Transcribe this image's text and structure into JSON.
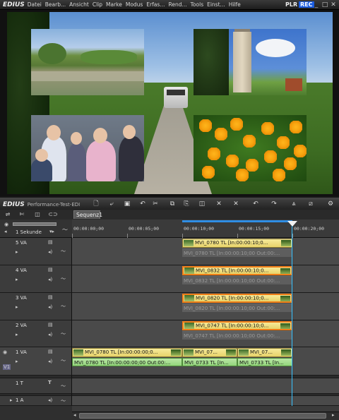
{
  "player": {
    "logo": "EDIUS",
    "menu": [
      "Datei",
      "Bearb...",
      "Ansicht",
      "Clip",
      "Marke",
      "Modus",
      "Erfas...",
      "Rend...",
      "Tools",
      "Einst...",
      "Hilfe"
    ],
    "plr": "PLR",
    "rec": "REC",
    "minimize": "_",
    "maximize": "□",
    "close": "✕"
  },
  "timeline": {
    "logo": "EDIUS",
    "project": "Performance-Test-EDI...",
    "sequence_tab": "Sequenz1",
    "zoom_label": "1 Sekunde",
    "ruler_labels": [
      "00:00:00;00",
      "00:00:05;00",
      "00:00:10;00",
      "00:00:15;00",
      "00:00:20;00"
    ],
    "tracks": [
      {
        "name": "5 VA"
      },
      {
        "name": "4 VA"
      },
      {
        "name": "3 VA"
      },
      {
        "name": "2 VA"
      },
      {
        "name": "1 VA"
      },
      {
        "name": "1 T"
      },
      {
        "name": "1 A"
      }
    ],
    "clips": {
      "v5": "MVI_0780   TL [In:00:00:10;0...",
      "a5": "MVI_0780   TL [In:00:00:10;00 Out:00:...",
      "v4": "MVI_0832   TL [In:00:00:10;0...",
      "a4": "MVI_0832   TL [In:00:00:10;00 Out:00:...",
      "v3": "MVI_0820   TL [In:00:00:10;0...",
      "a3": "MVI_0820   TL [In:00:00:10;00 Out:00:...",
      "v2": "MVI_0747   TL [In:00:00:10;0...",
      "a2": "MVI_0747   TL [In:00:00:10;00 Out:00:...",
      "v1a": "MVI_0780   TL [In:00:00:00;0...",
      "v1b": "MVI_07...",
      "v1c": "MVI_07...",
      "a1a": "MVI_0780  TL [In:00:00:00;00 Out:00:...",
      "a1b": "MVI_0733  TL [In...",
      "a1c": "MVI_0733  TL [In..."
    }
  }
}
